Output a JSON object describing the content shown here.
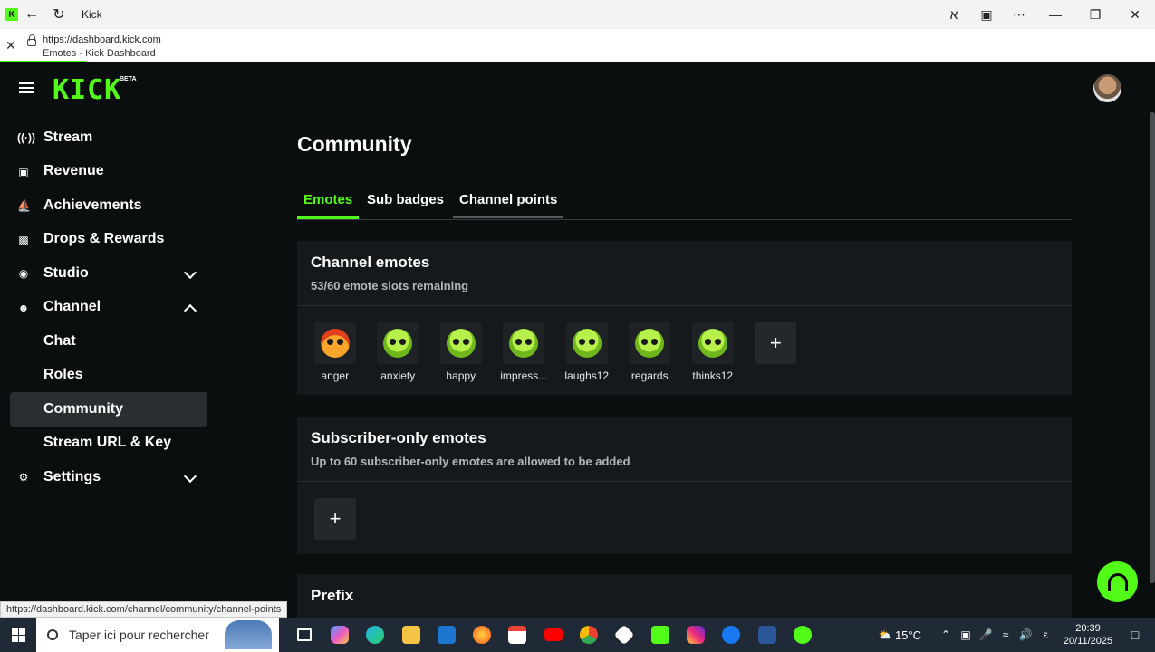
{
  "browser": {
    "title": "Kick",
    "url": "https://dashboard.kick.com",
    "page_title": "Emotes - Kick Dashboard",
    "status_url": "https://dashboard.kick.com/channel/community/channel-points"
  },
  "header": {
    "logo": "KICK",
    "beta": "BETA"
  },
  "sidebar": {
    "items": [
      {
        "label": "Stream",
        "icon": "broadcast-icon"
      },
      {
        "label": "Revenue",
        "icon": "wallet-icon"
      },
      {
        "label": "Achievements",
        "icon": "trophy-icon"
      },
      {
        "label": "Drops & Rewards",
        "icon": "gift-icon"
      },
      {
        "label": "Studio",
        "icon": "studio-icon"
      },
      {
        "label": "Channel",
        "icon": "people-icon"
      },
      {
        "label": "Chat"
      },
      {
        "label": "Roles"
      },
      {
        "label": "Community"
      },
      {
        "label": "Stream URL & Key"
      },
      {
        "label": "Settings",
        "icon": "gear-icon"
      }
    ]
  },
  "main": {
    "title": "Community",
    "tabs": [
      "Emotes",
      "Sub badges",
      "Channel points"
    ],
    "channel_emotes": {
      "title": "Channel emotes",
      "subtitle": "53/60 emote slots remaining",
      "emotes": [
        "anger",
        "anxiety",
        "happy",
        "impress...",
        "laughs12",
        "regards",
        "thinks12"
      ]
    },
    "subscriber_emotes": {
      "title": "Subscriber-only emotes",
      "subtitle": "Up to 60 subscriber-only emotes are allowed to be added"
    },
    "prefix": {
      "title": "Prefix"
    }
  },
  "taskbar": {
    "search_placeholder": "Taper ici pour rechercher",
    "temperature": "15°C",
    "time": "20:39",
    "date": "20/11/2025"
  },
  "colors": {
    "accent": "#53fc18",
    "background": "#0b0e0f",
    "card": "#16191b"
  }
}
